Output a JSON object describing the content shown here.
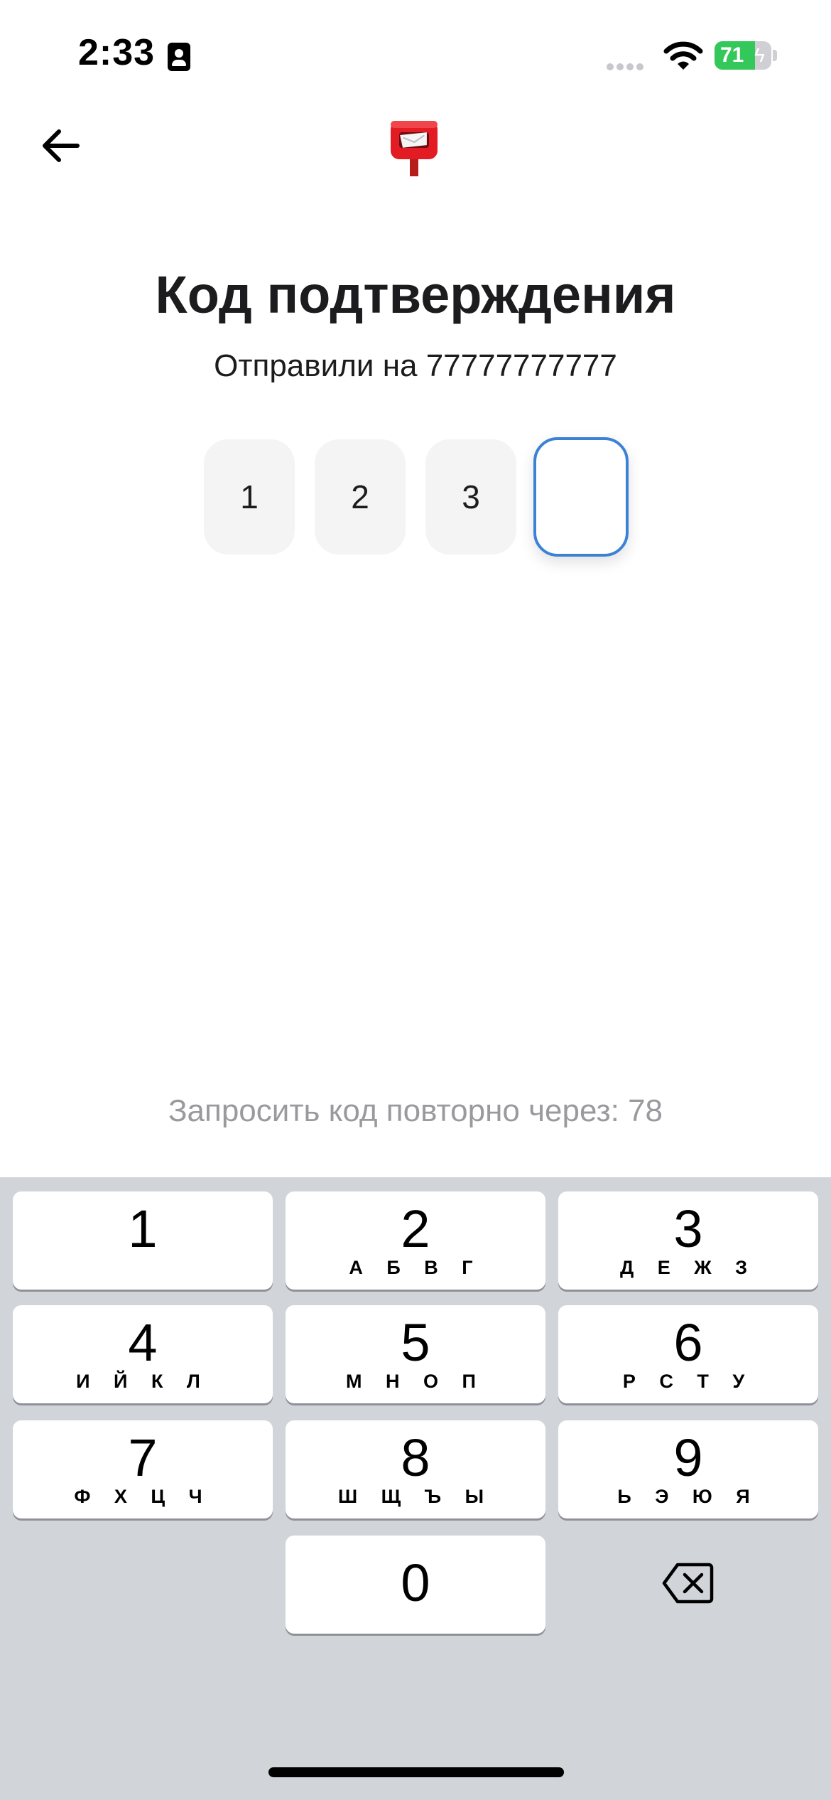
{
  "status_bar": {
    "time": "2:33",
    "battery_percent": "71",
    "battery_level": 0.71,
    "icons": [
      "contact-card-icon",
      "signal-icon",
      "wifi-icon",
      "battery-charging-icon"
    ]
  },
  "nav": {
    "back_icon": "arrow-left-icon",
    "logo_icon": "postbox-icon"
  },
  "header": {
    "title": "Код подтверждения",
    "subtitle": "Отправили на 77777777777"
  },
  "code": {
    "digits": [
      "1",
      "2",
      "3",
      ""
    ],
    "active_index": 3,
    "active_border_color": "#3b82d6"
  },
  "resend": {
    "text": "Запросить код повторно через: 78"
  },
  "keyboard": {
    "keys": [
      {
        "digit": "1",
        "letters": ""
      },
      {
        "digit": "2",
        "letters": "А Б В Г"
      },
      {
        "digit": "3",
        "letters": "Д Е Ж З"
      },
      {
        "digit": "4",
        "letters": "И Й К Л"
      },
      {
        "digit": "5",
        "letters": "М Н О П"
      },
      {
        "digit": "6",
        "letters": "Р С Т У"
      },
      {
        "digit": "7",
        "letters": "Ф Х Ц Ч"
      },
      {
        "digit": "8",
        "letters": "Ш Щ Ъ Ы"
      },
      {
        "digit": "9",
        "letters": "Ь Э Ю Я"
      },
      {
        "digit": "0",
        "letters": ""
      }
    ],
    "delete_icon": "backspace-icon",
    "background_color": "#d1d4d9"
  }
}
